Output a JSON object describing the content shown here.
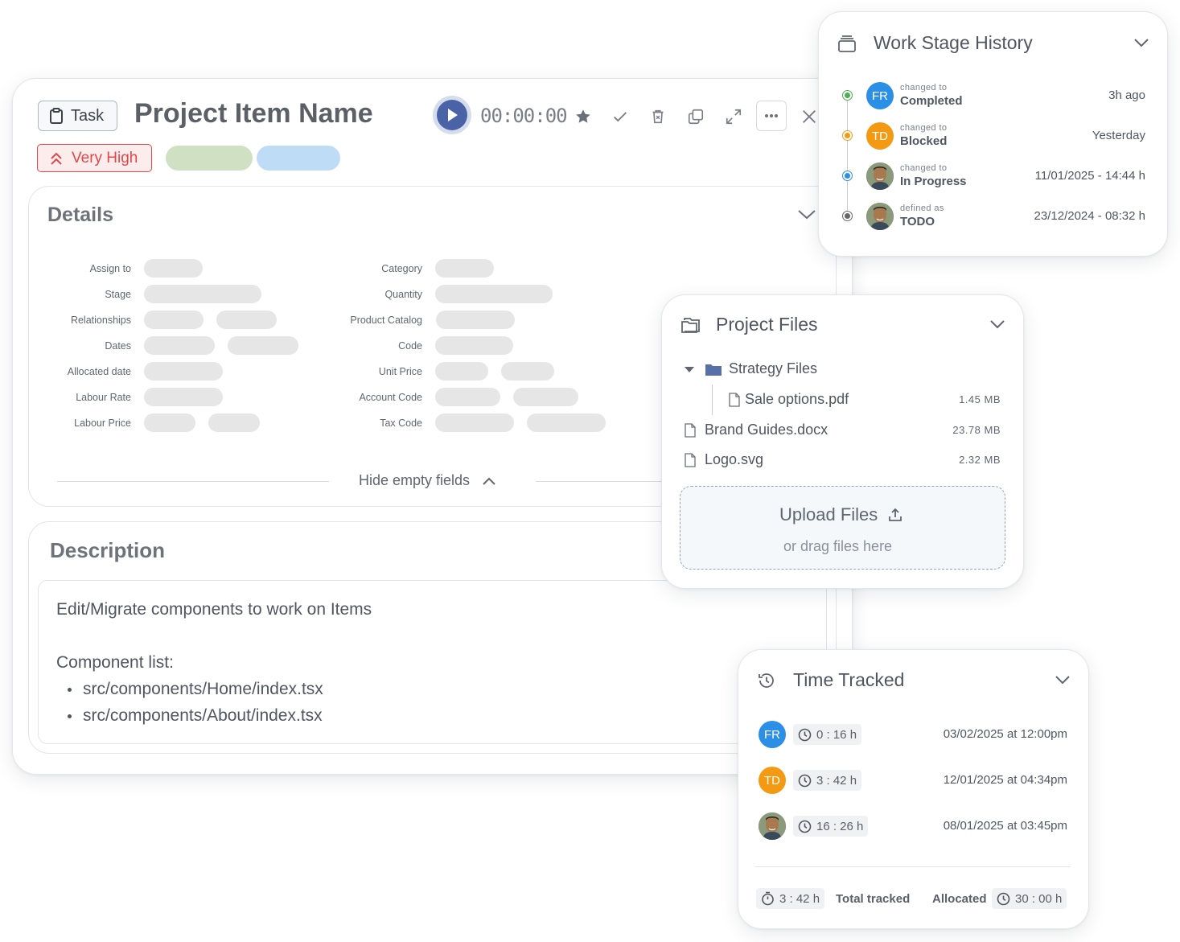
{
  "task": {
    "type_label": "Task",
    "title": "Project Item Name",
    "timer": "00:00:00",
    "priority": "Very High"
  },
  "details": {
    "title": "Details",
    "left_fields": [
      "Assign to",
      "Stage",
      "Relationships",
      "Dates",
      "Allocated date",
      "Labour Rate",
      "Labour Price"
    ],
    "right_fields": [
      "Category",
      "Quantity",
      "Product Catalog",
      "Code",
      "Unit Price",
      "Account Code",
      "Tax Code"
    ],
    "toggle_label": "Hide empty fields"
  },
  "description": {
    "title": "Description",
    "line1": "Edit/Migrate components to work on Items",
    "list_title": "Component list:",
    "items": [
      "src/components/Home/index.tsx",
      "src/components/About/index.tsx"
    ]
  },
  "history": {
    "title": "Work Stage History",
    "entries": [
      {
        "initials": "FR",
        "color": "#2b8fe6",
        "dot": "#4caf50",
        "verb": "changed to",
        "status": "Completed",
        "time": "3h ago"
      },
      {
        "initials": "TD",
        "color": "#f39a12",
        "dot": "#f39a12",
        "verb": "changed to",
        "status": "Blocked",
        "time": "Yesterday"
      },
      {
        "initials": "",
        "color": "#6b5a4a",
        "dot": "#2b8fe6",
        "verb": "changed to",
        "status": "In Progress",
        "time": "11/01/2025 - 14:44 h"
      },
      {
        "initials": "",
        "color": "#6b5a4a",
        "dot": "#666666",
        "verb": "defined as",
        "status": "TODO",
        "time": "23/12/2024 - 08:32 h"
      }
    ]
  },
  "files": {
    "title": "Project Files",
    "folder": "Strategy Files",
    "folder_files": [
      {
        "name": "Sale options.pdf",
        "size": "1.45 MB"
      }
    ],
    "files": [
      {
        "name": "Brand Guides.docx",
        "size": "23.78 MB"
      },
      {
        "name": "Logo.svg",
        "size": "2.32 MB"
      }
    ],
    "upload_label": "Upload Files",
    "upload_hint": "or drag files here"
  },
  "time": {
    "title": "Time Tracked",
    "entries": [
      {
        "initials": "FR",
        "color": "#2b8fe6",
        "duration": "0 : 16 h",
        "date": "03/02/2025 at 12:00pm"
      },
      {
        "initials": "TD",
        "color": "#f39a12",
        "duration": "3 : 42 h",
        "date": "12/01/2025 at 04:34pm"
      },
      {
        "initials": "",
        "color": "#6b5a4a",
        "duration": "16 : 26 h",
        "date": "08/01/2025 at 03:45pm"
      }
    ],
    "total_value": "3 : 42 h",
    "total_label": "Total tracked",
    "allocated_label": "Allocated",
    "allocated_value": "30 : 00 h"
  }
}
